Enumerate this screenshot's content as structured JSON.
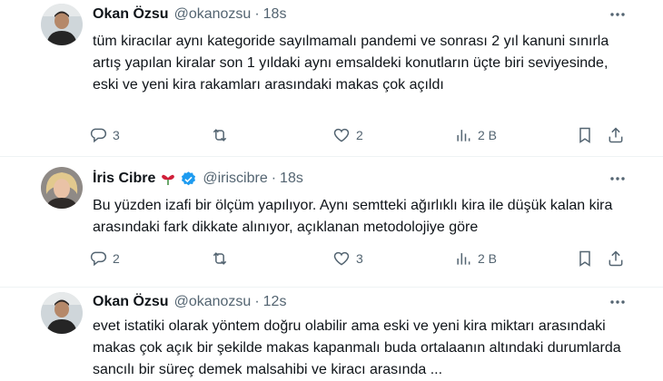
{
  "tweets": [
    {
      "name": "Okan Özsu",
      "handle": "@okanozsu",
      "separator": "·",
      "time": "18s",
      "text": "tüm kiracılar aynı kategoride sayılmamalı pandemi ve sonrası 2 yıl kanuni sınırla artış yapılan kiralar son 1 yıldaki aynı emsaldeki konutların üçte biri seviyesinde,\neski ve yeni kira rakamları arasındaki makas çok açıldı",
      "replies": "3",
      "retweets": "",
      "likes": "2",
      "views": "2 B"
    },
    {
      "name": "İris Cibre",
      "handle": "@iriscibre",
      "separator": "·",
      "time": "18s",
      "text": "Bu yüzden izafi bir ölçüm yapılıyor. Aynı semtteki ağırlıklı kira ile düşük kalan kira arasındaki fark dikkate alınıyor, açıklanan metodolojiye göre",
      "replies": "2",
      "retweets": "",
      "likes": "3",
      "views": "2 B"
    },
    {
      "name": "Okan Özsu",
      "handle": "@okanozsu",
      "separator": "·",
      "time": "12s",
      "text": "evet istatiki olarak yöntem doğru olabilir ama eski ve yeni kira miktarı arasındaki makas çok açık bir şekilde makas kapanmalı buda ortalaanın altındaki durumlarda sancılı bir süreç demek malsahibi ve kiracı arasında ..."
    }
  ],
  "colors": {
    "text": "#0f1419",
    "secondary": "#536471",
    "verified": "#1d9bf0",
    "divider": "#eff3f4"
  }
}
